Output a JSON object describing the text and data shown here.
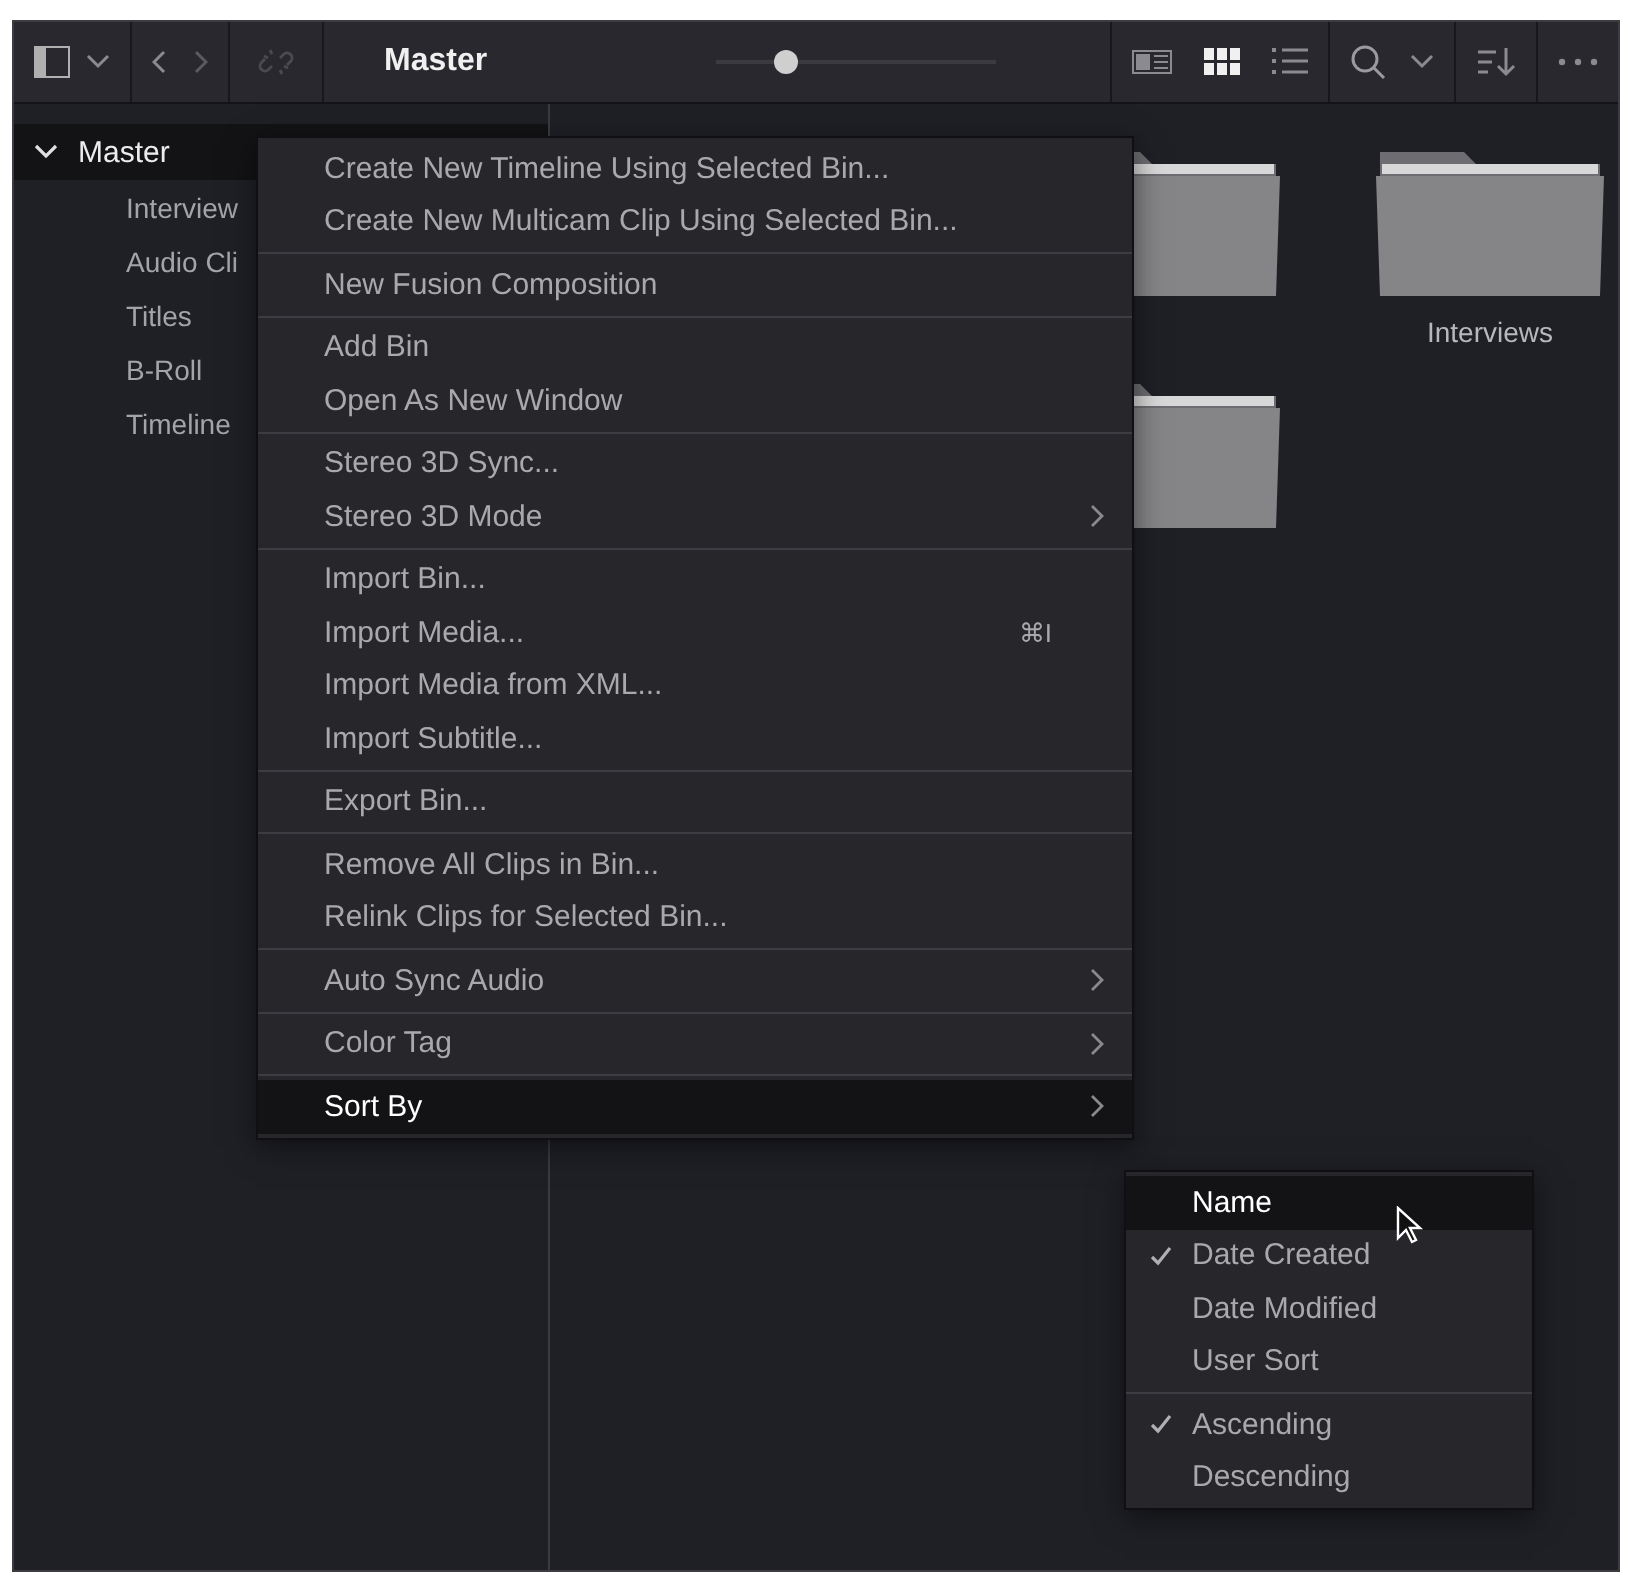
{
  "toolbar": {
    "title": "Master",
    "zoom_slider": {
      "level": 0.25
    },
    "view_modes": [
      {
        "kind": "metadata",
        "selected": false
      },
      {
        "kind": "thumbnails",
        "selected": true
      },
      {
        "kind": "list",
        "selected": false
      }
    ]
  },
  "sidebar": {
    "items": [
      {
        "label": "Master",
        "expanded": true,
        "selected": true,
        "children": [
          {
            "label": "Interview",
            "selected": false
          },
          {
            "label": "Audio Cli",
            "selected": false
          },
          {
            "label": "Titles",
            "selected": false
          },
          {
            "label": "B-Roll",
            "selected": false
          },
          {
            "label": "Timeline",
            "selected": false
          }
        ]
      }
    ]
  },
  "bins": [
    {
      "kind": "folder"
    },
    {
      "kind": "folder",
      "label": "Interviews"
    },
    {
      "kind": "folder"
    }
  ],
  "context_menu": {
    "sections": [
      [
        {
          "label": "Create New Timeline Using Selected Bin...",
          "submenu": false,
          "selected": false
        },
        {
          "label": "Create New Multicam Clip Using Selected Bin...",
          "submenu": false,
          "selected": false
        }
      ],
      [
        {
          "label": "New Fusion Composition",
          "submenu": false,
          "selected": false
        }
      ],
      [
        {
          "label": "Add Bin",
          "submenu": false,
          "selected": false
        },
        {
          "label": "Open As New Window",
          "submenu": false,
          "selected": false
        }
      ],
      [
        {
          "label": "Stereo 3D Sync...",
          "submenu": false,
          "selected": false
        },
        {
          "label": "Stereo 3D Mode",
          "submenu": true,
          "selected": false
        }
      ],
      [
        {
          "label": "Import Bin...",
          "submenu": false,
          "selected": false
        },
        {
          "label": "Import Media...",
          "shortcut": "⌘I",
          "submenu": false,
          "selected": false
        },
        {
          "label": "Import Media from XML...",
          "submenu": false,
          "selected": false
        },
        {
          "label": "Import Subtitle...",
          "submenu": false,
          "selected": false
        }
      ],
      [
        {
          "label": "Export Bin...",
          "submenu": false,
          "selected": false
        }
      ],
      [
        {
          "label": "Remove All Clips in Bin...",
          "submenu": false,
          "selected": false
        },
        {
          "label": "Relink Clips for Selected Bin...",
          "submenu": false,
          "selected": false
        }
      ],
      [
        {
          "label": "Auto Sync Audio",
          "submenu": true,
          "selected": false
        }
      ],
      [
        {
          "label": "Color Tag",
          "submenu": true,
          "selected": false
        }
      ],
      [
        {
          "label": "Sort By",
          "submenu": true,
          "selected": true
        }
      ]
    ]
  },
  "sort_submenu": {
    "sections": [
      [
        {
          "label": "Name",
          "checked": false,
          "selected": true
        },
        {
          "label": "Date Created",
          "checked": true,
          "selected": false
        },
        {
          "label": "Date Modified",
          "checked": false,
          "selected": false
        },
        {
          "label": "User Sort",
          "checked": false,
          "selected": false
        }
      ],
      [
        {
          "label": "Ascending",
          "checked": true,
          "selected": false
        },
        {
          "label": "Descending",
          "checked": false,
          "selected": false
        }
      ]
    ]
  }
}
